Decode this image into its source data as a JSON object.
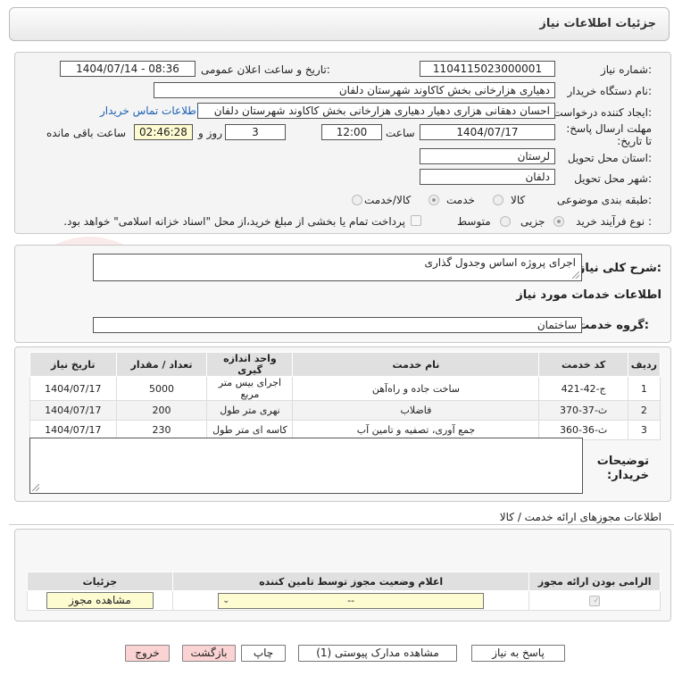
{
  "header": {
    "title": "جزئیات اطلاعات نیاز"
  },
  "details": {
    "need_number_label": "شماره نیاز:",
    "need_number": "1104115023000001",
    "announce_label": "تاریخ و ساعت اعلان عمومی:",
    "announce_value": "1404/07/14 - 08:36",
    "buyer_org_label": "نام دستگاه خریدار:",
    "buyer_org": "دهیاری هزارخانی بخش کاکاوند شهرستان دلفان",
    "creator_label": "ایجاد کننده درخواست:",
    "creator": "احسان دهقانی هزاری دهیار دهیاری هزارخانی بخش کاکاوند شهرستان دلفان",
    "contact_link": "اطلاعات تماس خریدار",
    "deadline_label": "مهلت ارسال پاسخ: تا تاریخ:",
    "deadline_date": "1404/07/17",
    "time_label": "ساعت",
    "deadline_time": "12:00",
    "days": "3",
    "days_label": "روز و",
    "remaining": "02:46:28",
    "remaining_label": "ساعت باقی مانده",
    "province_label": "استان محل تحویل:",
    "province": "لرستان",
    "city_label": "شهر محل تحویل:",
    "city": "دلفان",
    "category_label": "طبقه بندی موضوعی:",
    "category_options": [
      "کالا",
      "خدمت",
      "کالا/خدمت"
    ],
    "process_label": "نوع فرآیند خرید :",
    "process_options": [
      "جزیی",
      "متوسط"
    ],
    "payment_note": "پرداخت تمام یا بخشی از مبلغ خرید،از محل \"اسناد خزانه اسلامی\" خواهد بود."
  },
  "desc": {
    "label": "شرح کلی نیاز:",
    "value": "اجرای پروژه اساس وجدول گذاری"
  },
  "services": {
    "title": "اطلاعات خدمات مورد نیاز",
    "group_label": "گروه خدمت:",
    "group_value": "ساختمان",
    "columns": [
      "ردیف",
      "کد خدمت",
      "نام خدمت",
      "واحد اندازه گیری",
      "تعداد / مقدار",
      "تاریخ نیاز"
    ],
    "rows": [
      [
        "1",
        "ج-42-421",
        "ساخت جاده و راه‌آهن",
        "اجرای بیس متر مربع",
        "5000",
        "1404/07/17"
      ],
      [
        "2",
        "ث-37-370",
        "فاضلاب",
        "نهری متر طول",
        "200",
        "1404/07/17"
      ],
      [
        "3",
        "ث-36-360",
        "جمع آوری، تصفیه و تامین آب",
        "کاسه ای متر طول",
        "230",
        "1404/07/17"
      ]
    ],
    "buyer_notes_label": "توضیحات خریدار:"
  },
  "permits": {
    "title": "اطلاعات مجوزهای ارائه خدمت / کالا",
    "columns": [
      "الزامی بودن ارائه مجوز",
      "اعلام وضعیت مجوز توسط تامین کننده",
      "جزئیات"
    ],
    "select_value": "--",
    "view_button": "مشاهده مجوز"
  },
  "footer": {
    "reply": "پاسخ به نیاز",
    "attachments": "مشاهده مدارک پیوستی (1)",
    "print": "چاپ",
    "back": "بازگشت",
    "exit": "خروج"
  },
  "colors": {
    "accent_link": "#1a5fb4",
    "remaining_bg": "#fdfbd0",
    "exit_bg": "#fbd3d3"
  }
}
